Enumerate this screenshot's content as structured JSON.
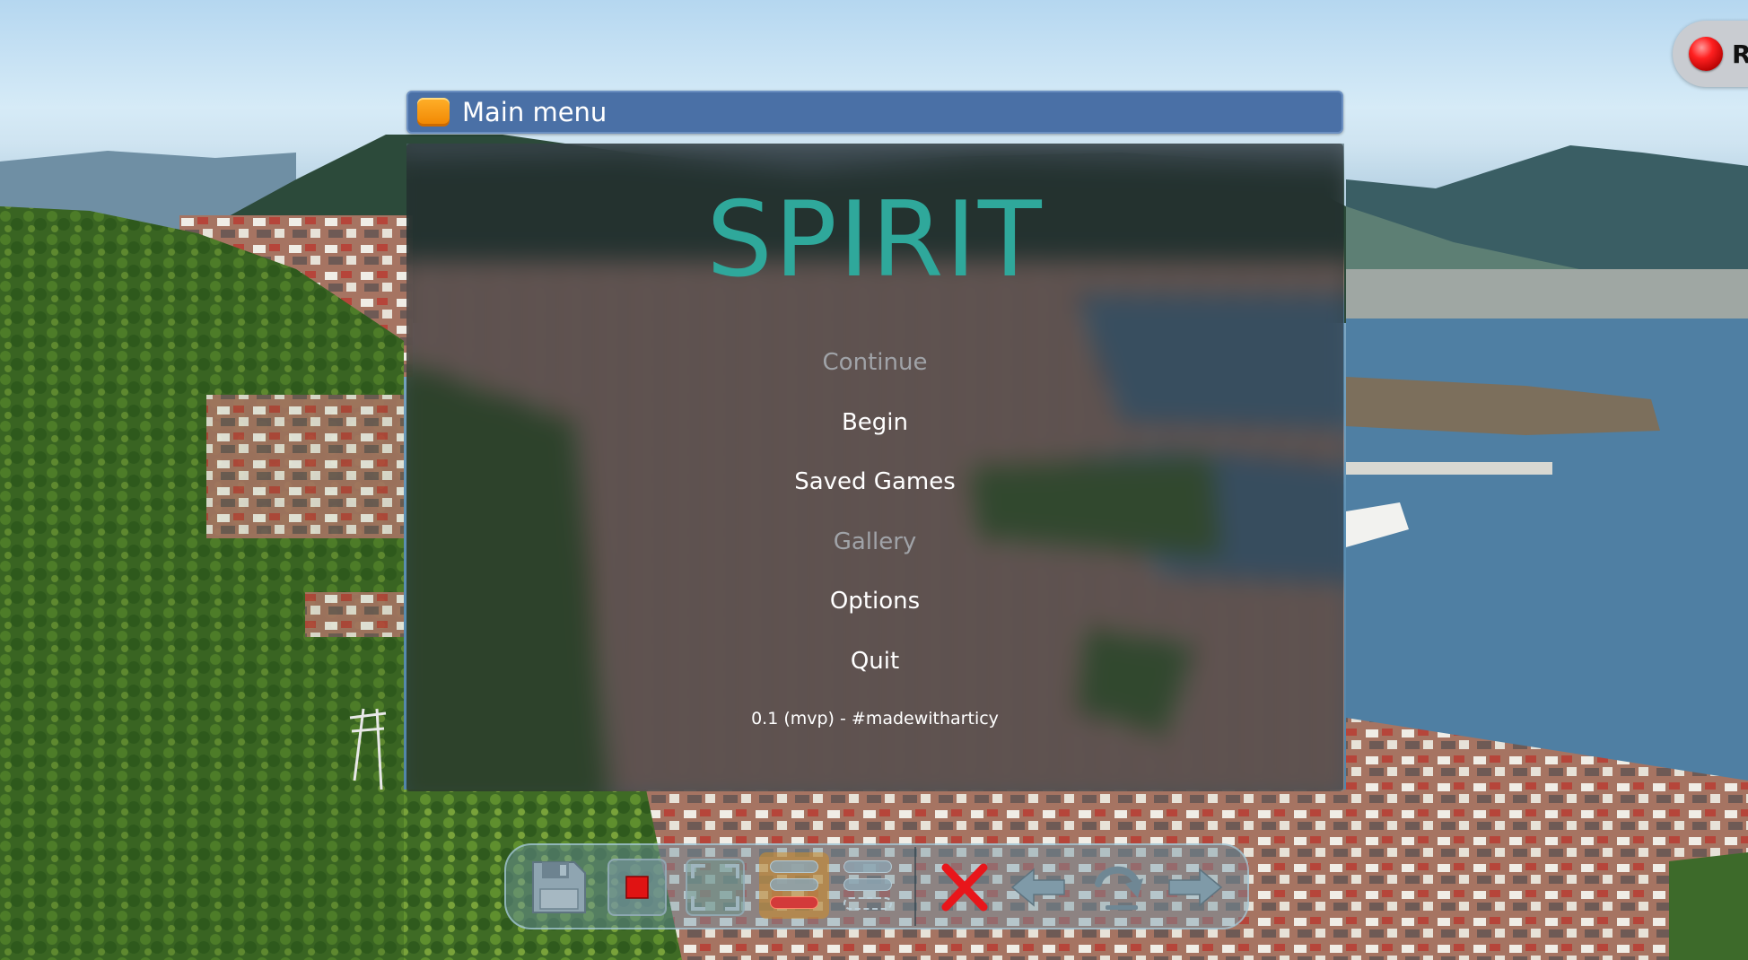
{
  "window": {
    "title": "Main menu"
  },
  "menu": {
    "game_title": "SPIRIT",
    "items": [
      {
        "label": "Continue",
        "enabled": false
      },
      {
        "label": "Begin",
        "enabled": true
      },
      {
        "label": "Saved Games",
        "enabled": true
      },
      {
        "label": "Gallery",
        "enabled": false
      },
      {
        "label": "Options",
        "enabled": true
      },
      {
        "label": "Quit",
        "enabled": true
      }
    ],
    "version": "0.1 (mvp) - #madewitharticy"
  },
  "record": {
    "label": "R",
    "icon": "record-dot-icon"
  },
  "toolbar": {
    "buttons": [
      {
        "name": "save-button",
        "icon": "floppy-disk-icon"
      },
      {
        "name": "stop-button",
        "icon": "stop-square-icon"
      },
      {
        "name": "fullscreen-button",
        "icon": "frame-corners-icon"
      },
      {
        "name": "history-button",
        "icon": "stacked-bars-highlighted-icon",
        "active": true
      },
      {
        "name": "skip-button",
        "icon": "stacked-bars-dashed-icon"
      },
      {
        "name": "close-button",
        "icon": "red-x-icon"
      },
      {
        "name": "back-button",
        "icon": "arrow-left-icon"
      },
      {
        "name": "rollback-button",
        "icon": "curved-return-arrow-icon"
      },
      {
        "name": "forward-button",
        "icon": "arrow-right-icon"
      }
    ]
  },
  "colors": {
    "title_bar": "#4a70a6",
    "game_title": "#2fa89b",
    "disabled_text": "#a0a3a8",
    "enabled_text": "#ffffff"
  }
}
